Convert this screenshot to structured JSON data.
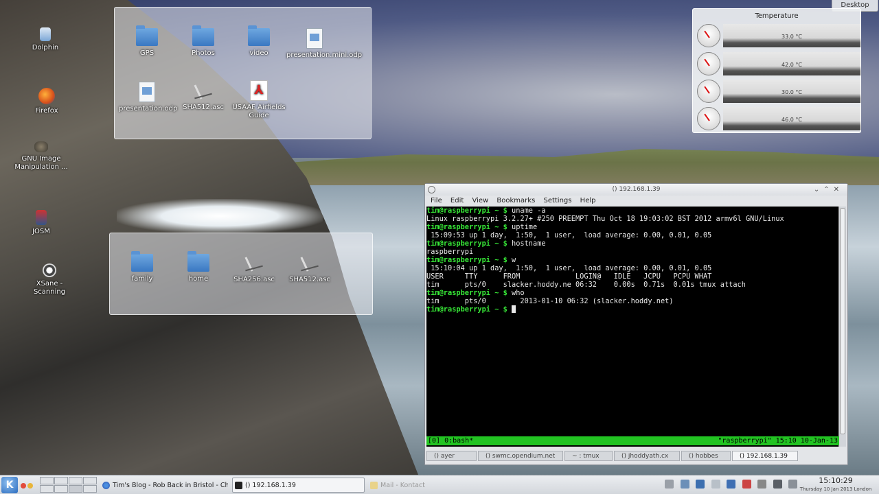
{
  "desktop": {
    "icons": [
      {
        "label": "Dolphin"
      },
      {
        "label": "Firefox"
      },
      {
        "label": "GNU Image Manipulation ..."
      },
      {
        "label": "JOSM"
      },
      {
        "label": "XSane - Scanning"
      }
    ],
    "desktop_button": "Desktop"
  },
  "folderview_top": {
    "items": [
      {
        "label": "GPS",
        "type": "folder"
      },
      {
        "label": "Photos",
        "type": "folder"
      },
      {
        "label": "video",
        "type": "folder"
      },
      {
        "label": "presentation.mini.odp",
        "type": "document"
      },
      {
        "label": "presentation.odp",
        "type": "document"
      },
      {
        "label": "SHA512.asc",
        "type": "signature"
      },
      {
        "label": "USAAF Airfields Guide",
        "type": "pdf"
      }
    ]
  },
  "folderview_bottom": {
    "items": [
      {
        "label": "family",
        "type": "folder"
      },
      {
        "label": "home",
        "type": "folder"
      },
      {
        "label": "SHA256.asc",
        "type": "signature"
      },
      {
        "label": "SHA512.asc",
        "type": "signature"
      }
    ]
  },
  "temperature_widget": {
    "title": "Temperature",
    "readings": [
      "33.0 °C",
      "42.0 °C",
      "30.0 °C",
      "46.0 °C"
    ]
  },
  "terminal": {
    "title": "() 192.168.1.39",
    "menu": [
      "File",
      "Edit",
      "View",
      "Bookmarks",
      "Settings",
      "Help"
    ],
    "prompt": "tim@raspberrypi ~ $ ",
    "lines": [
      {
        "prompt": true,
        "text": "uname -a"
      },
      {
        "prompt": false,
        "text": "Linux raspberrypi 3.2.27+ #250 PREEMPT Thu Oct 18 19:03:02 BST 2012 armv6l GNU/Linux"
      },
      {
        "prompt": true,
        "text": "uptime"
      },
      {
        "prompt": false,
        "text": " 15:09:53 up 1 day,  1:50,  1 user,  load average: 0.00, 0.01, 0.05"
      },
      {
        "prompt": true,
        "text": "hostname"
      },
      {
        "prompt": false,
        "text": "raspberrypi"
      },
      {
        "prompt": true,
        "text": "w"
      },
      {
        "prompt": false,
        "text": " 15:10:04 up 1 day,  1:50,  1 user,  load average: 0.00, 0.01, 0.05"
      },
      {
        "prompt": false,
        "text": "USER     TTY      FROM             LOGIN@   IDLE   JCPU   PCPU WHAT"
      },
      {
        "prompt": false,
        "text": "tim      pts/0    slacker.hoddy.ne 06:32    0.00s  0.71s  0.01s tmux attach"
      },
      {
        "prompt": true,
        "text": "who"
      },
      {
        "prompt": false,
        "text": "tim      pts/0        2013-01-10 06:32 (slacker.hoddy.net)"
      },
      {
        "prompt": true,
        "text": ""
      }
    ],
    "tmux_left": "[0] 0:bash*",
    "tmux_right": "\"raspberrypi\" 15:10 10-Jan-13",
    "tabs": [
      "() ayer",
      "() swmc.opendium.net",
      "~ : tmux",
      "() jhoddyath.cx",
      "() hobbes",
      "() 192.168.1.39"
    ]
  },
  "taskbar": {
    "kmenu": "K",
    "tasks": [
      {
        "label": "Tim's Blog - Rob Back in Bristol - Chro"
      },
      {
        "label": "() 192.168.1.39"
      },
      {
        "label": "Mail - Kontact"
      }
    ],
    "clock_time": "15:10:29",
    "clock_date": "Thursday 10 Jan 2013 London"
  }
}
